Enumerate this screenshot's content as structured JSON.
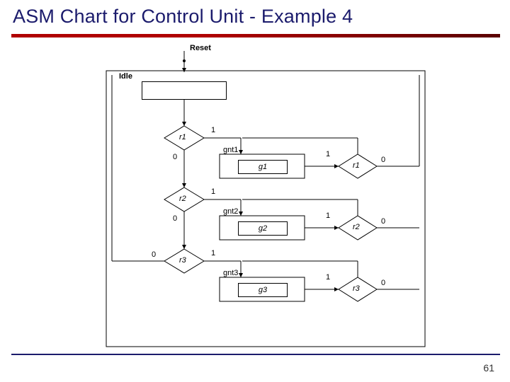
{
  "title": "ASM Chart for Control Unit - Example 4",
  "page_number": "61",
  "labels": {
    "reset": "Reset",
    "idle": "Idle",
    "r1": "r1",
    "r2": "r2",
    "r3": "r3",
    "r1b": "r1",
    "r2b": "r2",
    "r3b": "r3",
    "gnt1": "gnt1",
    "gnt2": "gnt2",
    "gnt3": "gnt3",
    "g1": "g1",
    "g2": "g2",
    "g3": "g3",
    "one": "1",
    "zero": "0"
  },
  "chart_data": {
    "type": "asm",
    "states": [
      {
        "name": "Idle",
        "outputs": []
      },
      {
        "name": "gnt1",
        "outputs": [
          "g1"
        ]
      },
      {
        "name": "gnt2",
        "outputs": [
          "g2"
        ]
      },
      {
        "name": "gnt3",
        "outputs": [
          "g3"
        ]
      }
    ],
    "reset_target": "Idle",
    "transitions": [
      {
        "from": "Idle",
        "condition": "r1",
        "if_true": "gnt1",
        "if_false": "check_r2"
      },
      {
        "from": "check_r2",
        "condition": "r2",
        "if_true": "gnt2",
        "if_false": "check_r3"
      },
      {
        "from": "check_r3",
        "condition": "r3",
        "if_true": "gnt3",
        "if_false": "Idle"
      },
      {
        "from": "gnt1",
        "condition": "r1",
        "if_true": "gnt1",
        "if_false": "Idle"
      },
      {
        "from": "gnt2",
        "condition": "r2",
        "if_true": "gnt2",
        "if_false": "Idle"
      },
      {
        "from": "gnt3",
        "condition": "r3",
        "if_true": "gnt3",
        "if_false": "Idle"
      }
    ]
  }
}
